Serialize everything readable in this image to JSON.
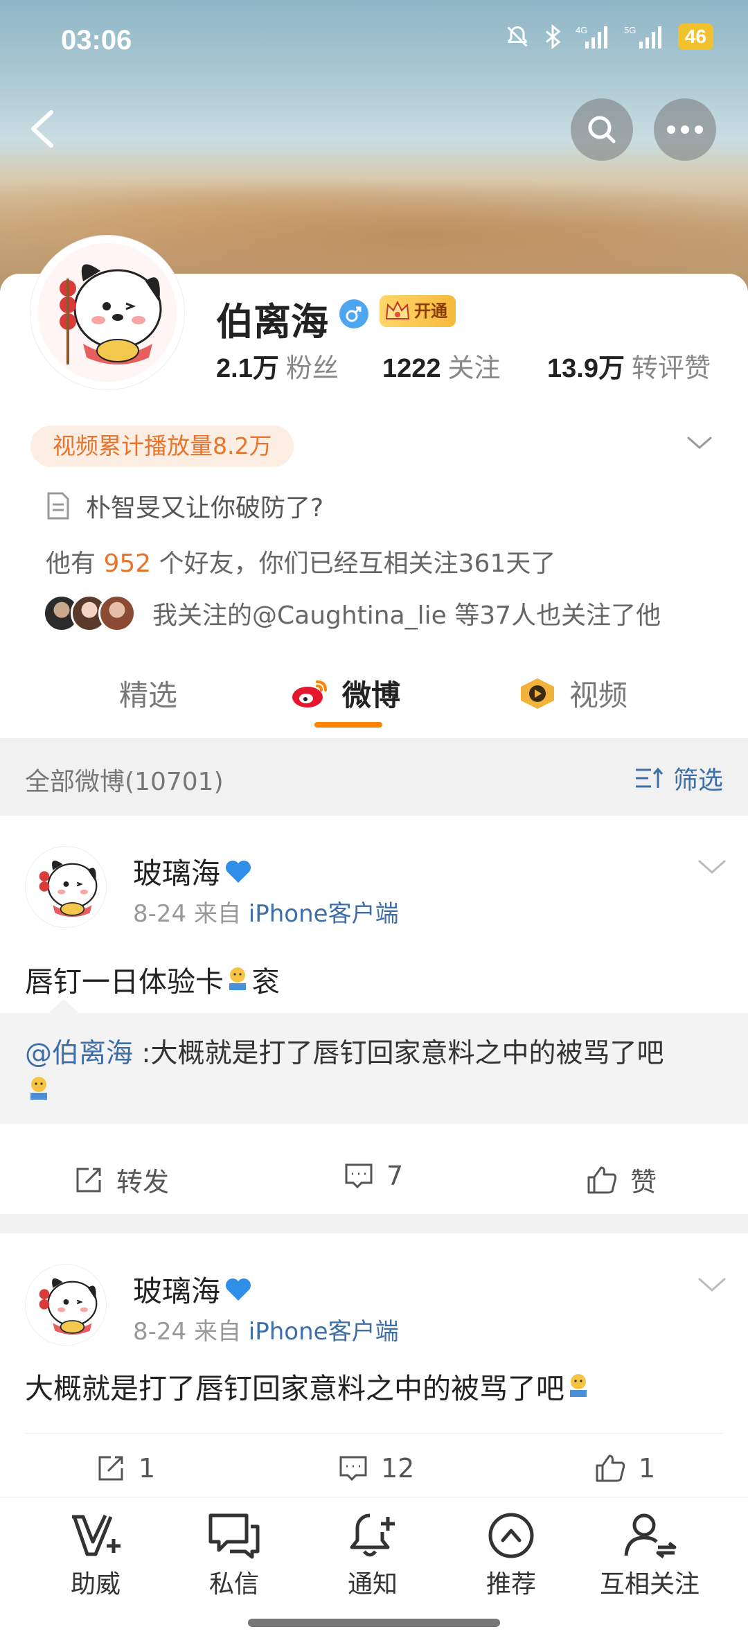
{
  "status_bar": {
    "time": "03:06",
    "battery": "46"
  },
  "profile": {
    "name": "伯离海",
    "vip_label": "开通",
    "stats": [
      {
        "value": "2.1万",
        "label": "粉丝"
      },
      {
        "value": "1222",
        "label": "关注"
      },
      {
        "value": "13.9万",
        "label": "转评赞"
      }
    ],
    "video_plays": "视频累计播放量8.2万",
    "bio": "朴智旻又让你破防了?",
    "friends": {
      "prefix": "他有",
      "count": "952",
      "suffix": "个好友，你们已经互相关注361天了"
    },
    "mutual_follow": "我关注的@Caughtina_lie 等37人也关注了他"
  },
  "tabs": [
    {
      "label": "精选"
    },
    {
      "label": "微博",
      "active": true
    },
    {
      "label": "视频"
    }
  ],
  "filter": {
    "count_label": "全部微博(10701)",
    "button_label": "筛选"
  },
  "posts": [
    {
      "author": "玻璃海",
      "date": "8-24",
      "from": "来自",
      "source": "iPhone客户端",
      "text_before": "唇钉一日体验卡",
      "text_after": "衮",
      "quote_mention": "@伯离海",
      "quote_text": " :大概就是打了唇钉回家意料之中的被骂了吧",
      "actions": {
        "repost": "转发",
        "comment": "7",
        "like": "赞"
      }
    },
    {
      "author": "玻璃海",
      "date": "8-24",
      "from": "来自",
      "source": "iPhone客户端",
      "text_before": "大概就是打了唇钉回家意料之中的被骂了吧",
      "actions": {
        "repost": "1",
        "comment": "12",
        "like": "1"
      }
    }
  ],
  "bottom_bar": [
    {
      "label": "助威",
      "icon": "boost-v-icon"
    },
    {
      "label": "私信",
      "icon": "message-icon"
    },
    {
      "label": "通知",
      "icon": "bell-plus-icon"
    },
    {
      "label": "推荐",
      "icon": "recommend-up-icon"
    },
    {
      "label": "互相关注",
      "icon": "mutual-follow-icon"
    }
  ],
  "colors": {
    "accent_orange": "#ff8200",
    "link_blue": "#3e6ea8",
    "vip_gold": "#f6b93b"
  }
}
